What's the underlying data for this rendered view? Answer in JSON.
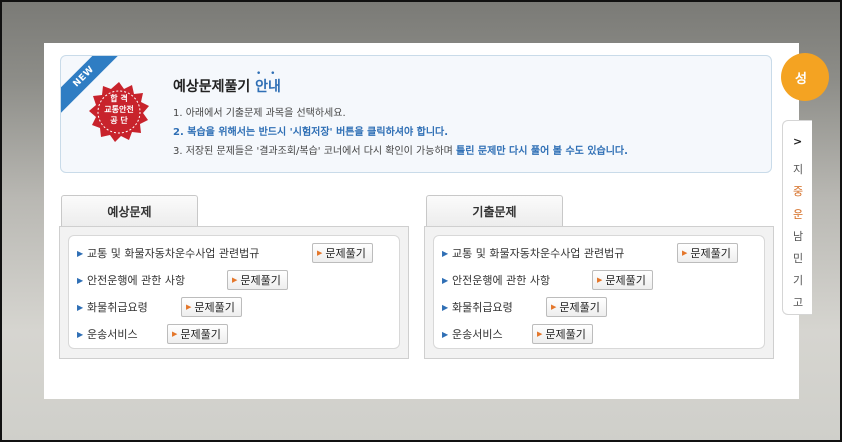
{
  "notice": {
    "ribbon": "NEW",
    "seal_lines": [
      "합 격",
      "교통안전",
      "공 단"
    ],
    "title_main": "예상문제풀기",
    "title_accent": "안내",
    "line1": "1. 아래에서 기출문제 과목을 선택하세요.",
    "line2": "2. 복습을 위해서는 반드시 '시험저장' 버튼을 클릭하셔야 합니다.",
    "line3_prefix": "3. 저장된 문제들은 '결과조회/복습' 코너에서 다시 확인이 가능하며 ",
    "line3_highlight": "틀린 문제만 다시 풀어 볼 수도 있습니다."
  },
  "panels": {
    "expected": {
      "tab_label": "예상문제",
      "items": [
        {
          "label": "교통 및 화물자동차운수사업 관련법규",
          "button": "문제풀기"
        },
        {
          "label": "안전운행에 관한 사항",
          "button": "문제풀기"
        },
        {
          "label": "화물취급요령",
          "button": "문제풀기"
        },
        {
          "label": "운송서비스",
          "button": "문제풀기"
        }
      ]
    },
    "past": {
      "tab_label": "기출문제",
      "items": [
        {
          "label": "교통 및 화물자동차운수사업 관련법규",
          "button": "문제풀기"
        },
        {
          "label": "안전운행에 관한 사항",
          "button": "문제풀기"
        },
        {
          "label": "화물취급요령",
          "button": "문제풀기"
        },
        {
          "label": "운송서비스",
          "button": "문제풀기"
        }
      ]
    }
  },
  "side": {
    "circle_text": "성",
    "items": [
      ">",
      "지",
      "중",
      "운",
      "남",
      "민",
      "기",
      "고"
    ]
  },
  "colors": {
    "accent_blue": "#2f6fb5",
    "seal_red": "#c8232c",
    "orange": "#f4a322"
  }
}
